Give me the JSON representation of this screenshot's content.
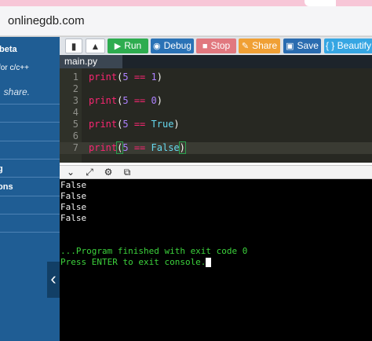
{
  "browser": {
    "url": "onlinegdb.com"
  },
  "sidebar": {
    "beta_text": "beta",
    "for_text": "for c/c++",
    "share_text": ". share.",
    "item_g": "g",
    "item_ons": "ons",
    "collapse_icon": "chevron-left-icon"
  },
  "toolbar": {
    "new_icon": "file-icon",
    "upload_icon": "upload-icon",
    "run_label": "Run",
    "debug_label": "Debug",
    "stop_label": "Stop",
    "share_label": "Share",
    "save_label": "Save",
    "beautify_label": "{ } Beautify"
  },
  "file_tab": {
    "name": "main.py"
  },
  "editor": {
    "line_numbers": [
      "1",
      "2",
      "3",
      "4",
      "5",
      "6",
      "7"
    ],
    "lines": [
      "print(5 == 1)",
      "",
      "print(5 == 0)",
      "",
      "print(5 == True)",
      "",
      "print(5 == False)"
    ]
  },
  "console": {
    "output_lines": [
      "False",
      "False",
      "False",
      "False"
    ],
    "finished_message": "...Program finished with exit code 0",
    "prompt_message": "Press ENTER to exit console."
  },
  "colors": {
    "sidebar": "#1f5d94",
    "run": "#2eac4f",
    "debug": "#2a72b6",
    "stop": "#e1787f",
    "share": "#f0a035",
    "save": "#2a6cb0",
    "beautify": "#36a6e3",
    "console_green": "#3cd23c"
  }
}
